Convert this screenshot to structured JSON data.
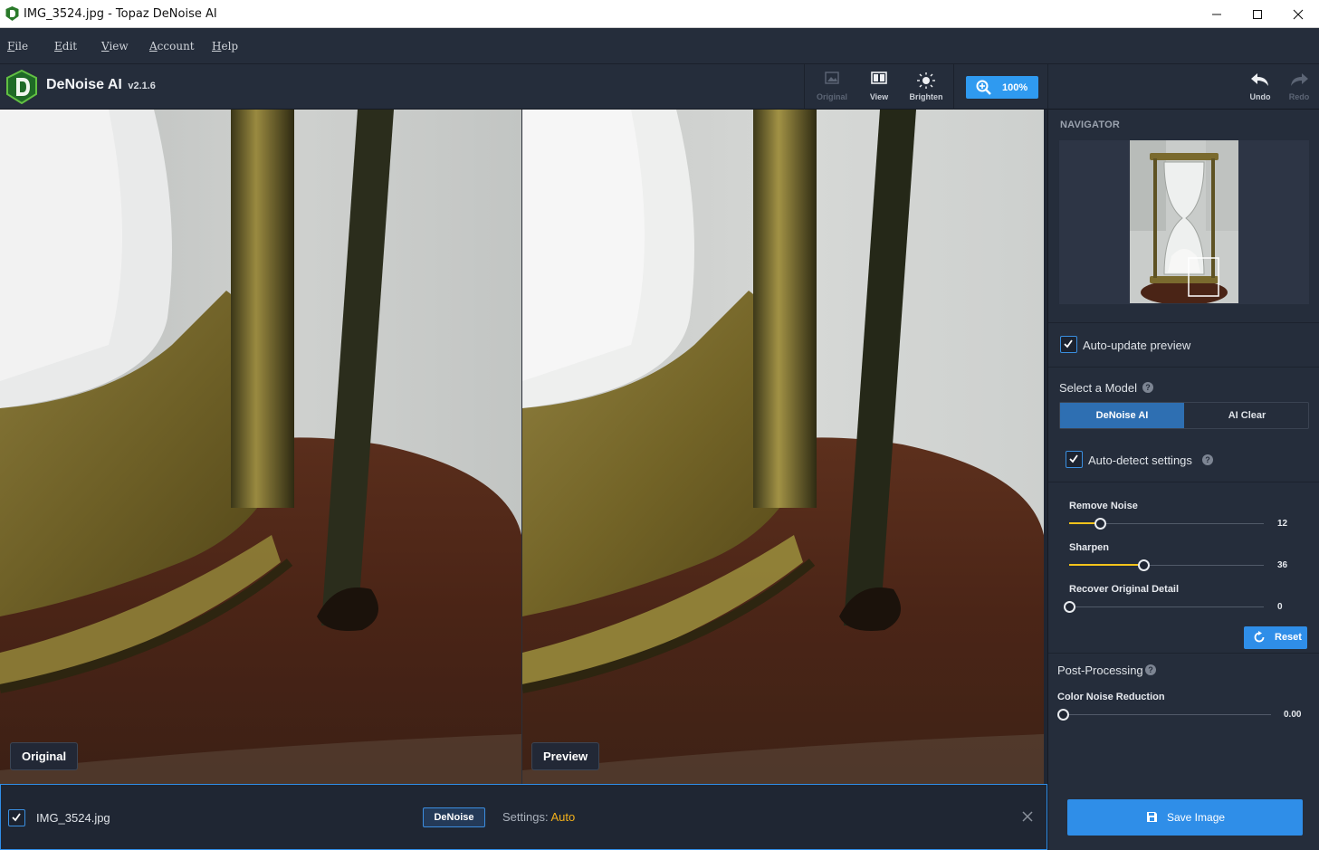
{
  "window": {
    "title": "IMG_3524.jpg - Topaz DeNoise AI"
  },
  "menu": [
    "File",
    "Edit",
    "View",
    "Account",
    "Help"
  ],
  "app": {
    "name": "DeNoise AI",
    "version": "v2.1.6"
  },
  "toolbar": {
    "original_label": "Original",
    "view_label": "View",
    "brighten_label": "Brighten",
    "zoom_label": "100%",
    "undo_label": "Undo",
    "redo_label": "Redo"
  },
  "panes": {
    "left_label": "Original",
    "right_label": "Preview"
  },
  "panel": {
    "navigator_title": "NAVIGATOR",
    "auto_update_label": "Auto-update preview",
    "auto_update_checked": true,
    "select_model_label": "Select a Model",
    "models": [
      "DeNoise AI",
      "AI Clear"
    ],
    "active_model": "DeNoise AI",
    "auto_detect_label": "Auto-detect settings",
    "auto_detect_checked": true,
    "sliders": [
      {
        "label": "Remove Noise",
        "value": "12",
        "fraction": 0.16
      },
      {
        "label": "Sharpen",
        "value": "36",
        "fraction": 0.38
      },
      {
        "label": "Recover Original Detail",
        "value": "0",
        "fraction": 0.0
      }
    ],
    "reset_label": "Reset",
    "post_processing_label": "Post-Processing",
    "color_noise": {
      "label": "Color Noise Reduction",
      "value": "0.00",
      "fraction": 0.0
    }
  },
  "bottom": {
    "file_checked": true,
    "filename": "IMG_3524.jpg",
    "model_tag": "DeNoise",
    "settings_label": "Settings:",
    "settings_value": "Auto",
    "save_label": "Save Image"
  },
  "colors": {
    "accent": "#2f8ee8",
    "slider_fill": "#f2c31b",
    "panel_bg": "#252d3b"
  }
}
